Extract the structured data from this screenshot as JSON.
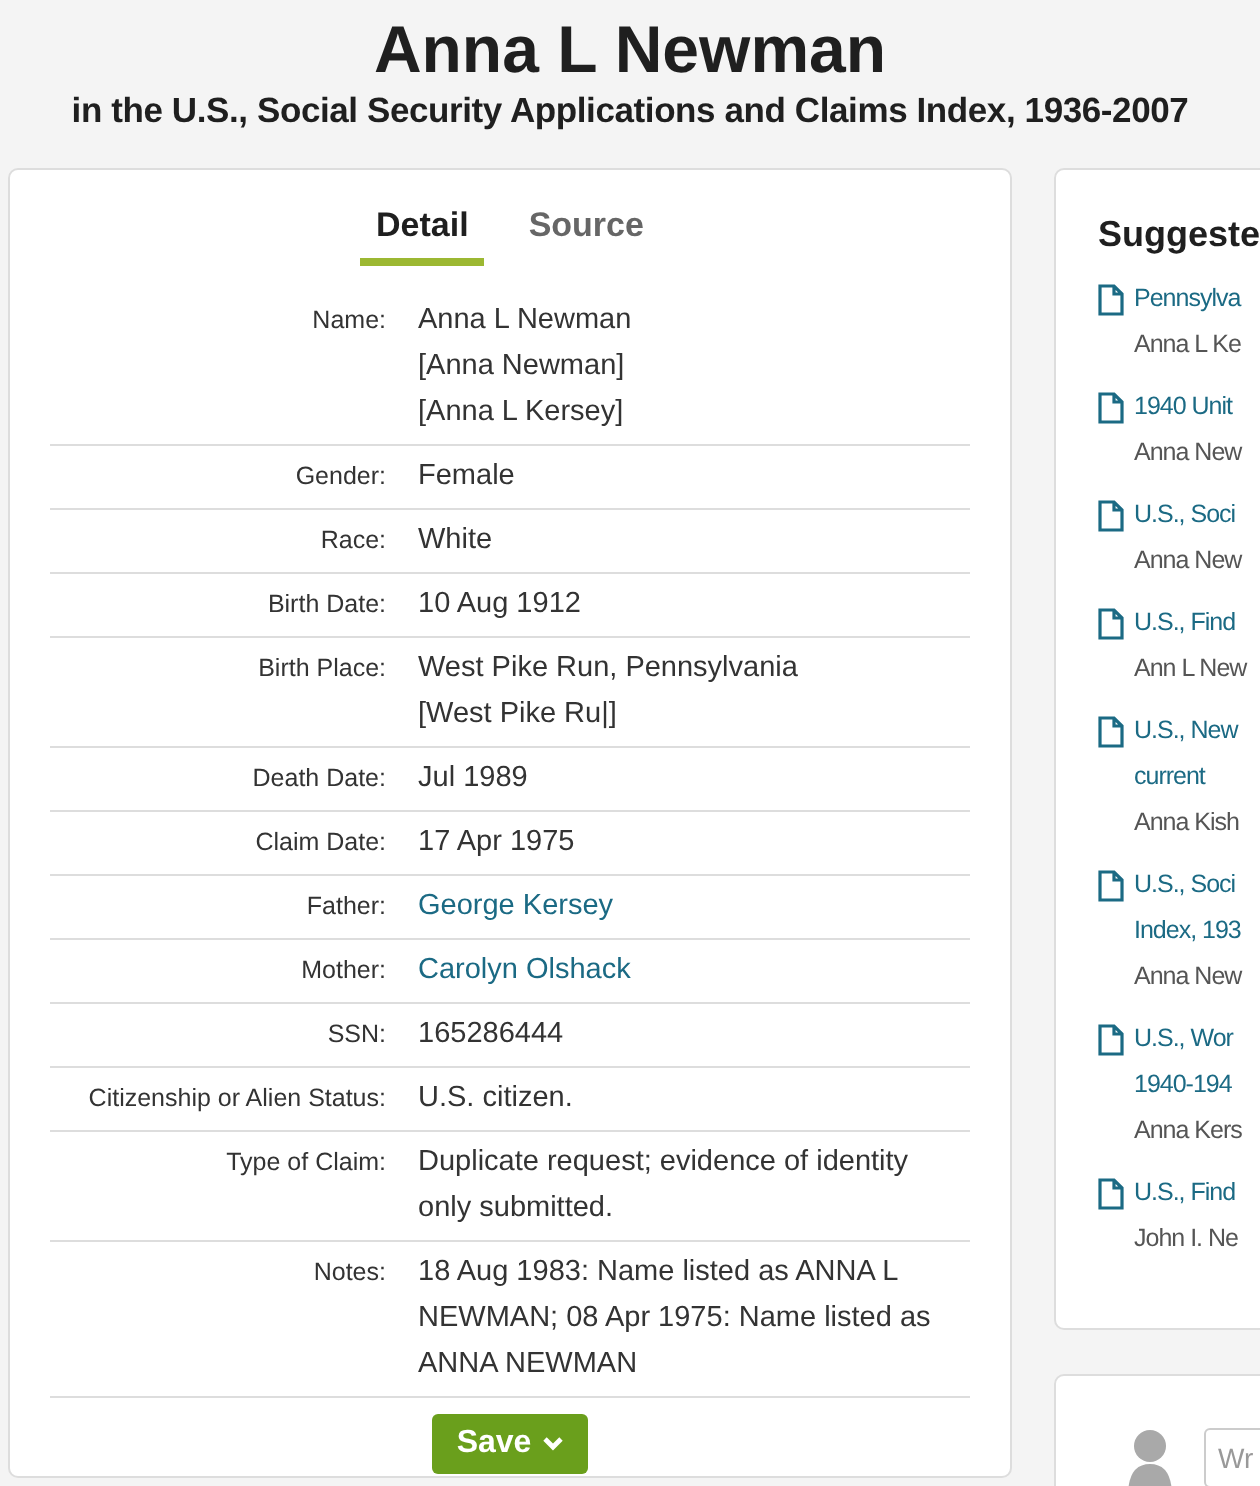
{
  "header": {
    "title": "Anna L Newman",
    "subtitle": "in the U.S., Social Security Applications and Claims Index, 1936-2007"
  },
  "tabs": [
    {
      "label": "Detail",
      "selected": true
    },
    {
      "label": "Source",
      "selected": false
    }
  ],
  "fields": [
    {
      "label": "Name:",
      "kind": "text",
      "lines": [
        "Anna L Newman",
        "[Anna Newman]",
        "[Anna L Kersey]"
      ]
    },
    {
      "label": "Gender:",
      "kind": "text",
      "lines": [
        "Female"
      ]
    },
    {
      "label": "Race:",
      "kind": "text",
      "lines": [
        "White"
      ]
    },
    {
      "label": "Birth Date:",
      "kind": "text",
      "lines": [
        "10 Aug 1912"
      ]
    },
    {
      "label": "Birth Place:",
      "kind": "text",
      "lines": [
        "West Pike Run, Pennsylvania",
        "[West Pike Ru|]"
      ]
    },
    {
      "label": "Death Date:",
      "kind": "text",
      "lines": [
        "Jul 1989"
      ]
    },
    {
      "label": "Claim Date:",
      "kind": "text",
      "lines": [
        "17 Apr 1975"
      ]
    },
    {
      "label": "Father:",
      "kind": "link",
      "lines": [
        "George Kersey"
      ]
    },
    {
      "label": "Mother:",
      "kind": "link",
      "lines": [
        "Carolyn Olshack"
      ]
    },
    {
      "label": "SSN:",
      "kind": "text",
      "lines": [
        "165286444"
      ]
    },
    {
      "label": "Citizenship or Alien Status:",
      "kind": "text",
      "lines": [
        "U.S. citizen."
      ]
    },
    {
      "label": "Type of Claim:",
      "kind": "text",
      "lines": [
        "Duplicate request; evidence of identity only submitted."
      ]
    },
    {
      "label": "Notes:",
      "kind": "text",
      "lines": [
        "18 Aug 1983: Name listed as ANNA L NEWMAN; 08 Apr 1975: Name listed as ANNA NEWMAN"
      ]
    }
  ],
  "save_button": {
    "label": "Save"
  },
  "suggested": {
    "title": "Suggeste",
    "items": [
      {
        "title_lines": [
          "Pennsylva"
        ],
        "name": "Anna L Ke"
      },
      {
        "title_lines": [
          "1940 Unit"
        ],
        "name": "Anna New"
      },
      {
        "title_lines": [
          "U.S., Soci"
        ],
        "name": "Anna New"
      },
      {
        "title_lines": [
          "U.S., Find"
        ],
        "name": "Ann L New"
      },
      {
        "title_lines": [
          "U.S., New",
          "current"
        ],
        "name": "Anna Kish"
      },
      {
        "title_lines": [
          "U.S., Soci",
          "Index, 193"
        ],
        "name": "Anna New"
      },
      {
        "title_lines": [
          "U.S., Wor",
          "1940-194"
        ],
        "name": "Anna Kers"
      },
      {
        "title_lines": [
          "U.S., Find"
        ],
        "name": "John I. Ne"
      }
    ]
  },
  "comment": {
    "placeholder": "Wr"
  }
}
